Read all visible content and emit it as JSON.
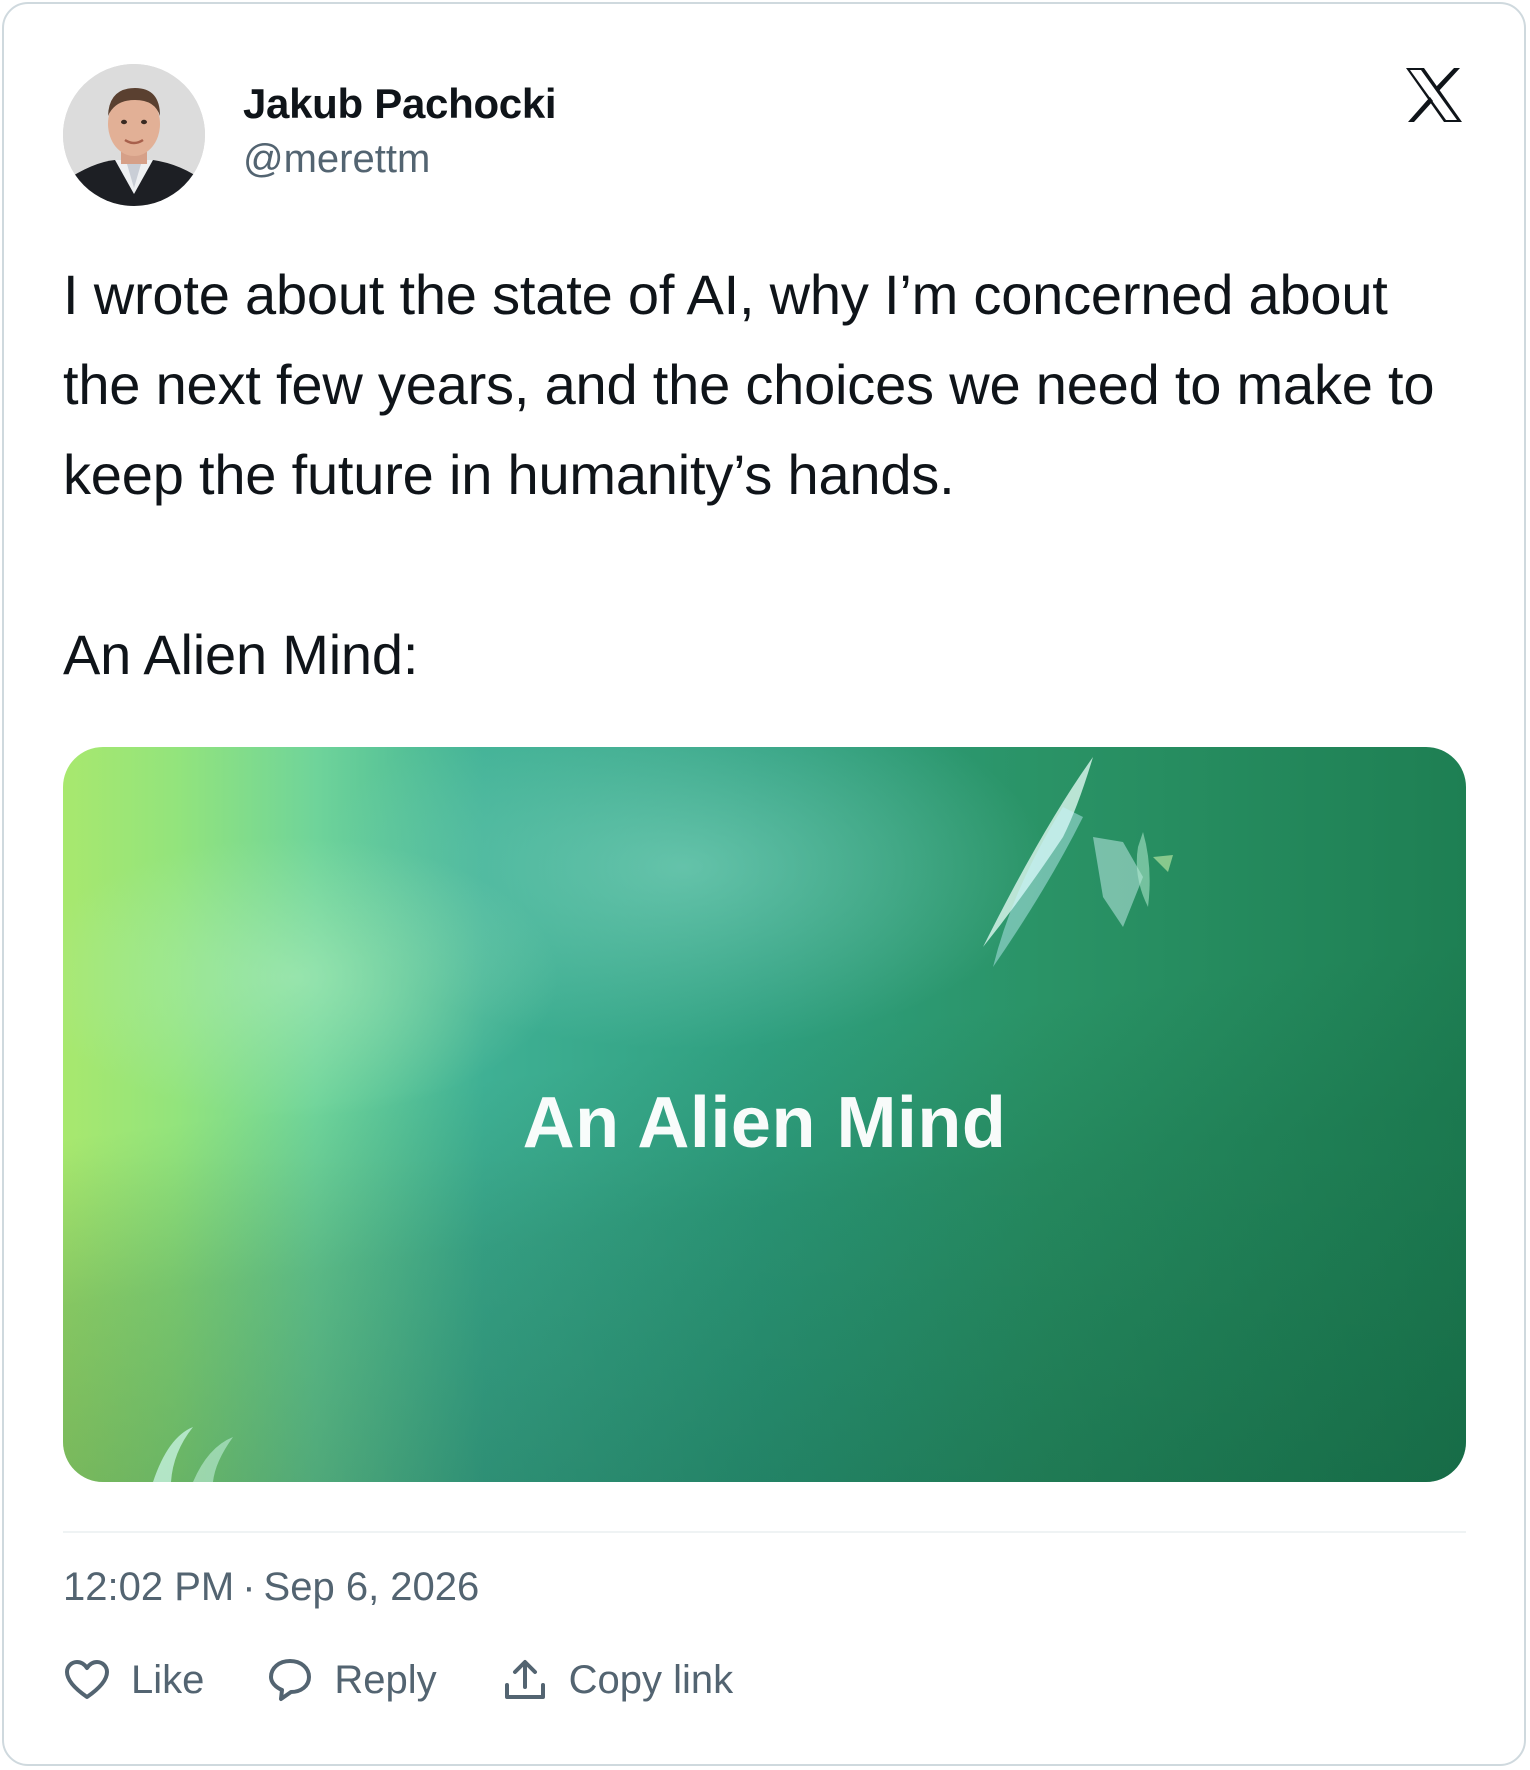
{
  "author": {
    "name": "Jakub Pachocki",
    "handle": "@merettm"
  },
  "tweet": {
    "paragraphs": [
      "I wrote about the state of AI, why I’m concerned about the next few years, and the choices we need to make to keep the future in humanity’s hands.",
      "An Alien Mind:"
    ],
    "media_title": "An Alien Mind",
    "time": "12:02 PM",
    "separator": "·",
    "date": "Sep 6, 2026"
  },
  "actions": {
    "like_label": "Like",
    "reply_label": "Reply",
    "copy_link_label": "Copy link"
  },
  "icons": {
    "brand": "x-logo-icon",
    "like": "heart-icon",
    "reply": "speech-bubble-icon",
    "copy_link": "upload-icon"
  },
  "colors": {
    "text_primary": "#0f1419",
    "text_secondary": "#536471",
    "border": "#cfd9de",
    "divider": "#eff3f4"
  }
}
